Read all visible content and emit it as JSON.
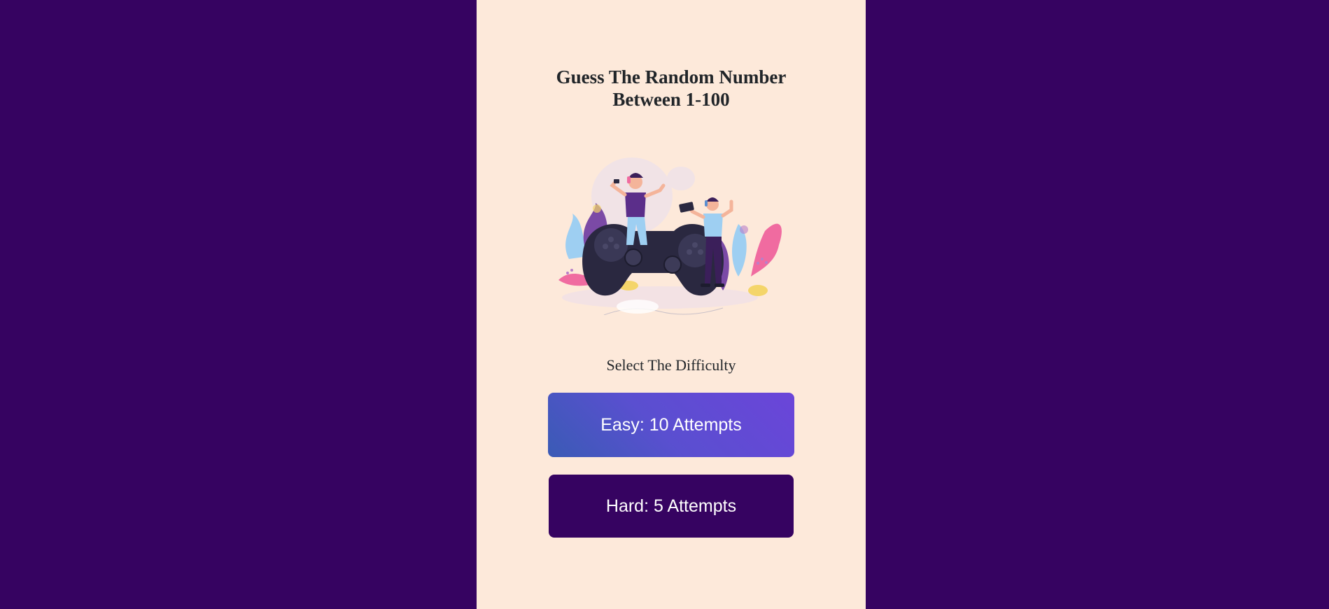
{
  "game": {
    "title_line1": "Guess The Random Number",
    "title_line2": "Between 1-100",
    "difficulty_prompt": "Select The Difficulty",
    "buttons": {
      "easy_label": "Easy: 10 Attempts",
      "hard_label": "Hard: 5 Attempts"
    },
    "illustration_alt": "gamers-illustration"
  },
  "colors": {
    "background": "#360361",
    "panel": "#fde9da",
    "text": "#212529",
    "easy_gradient_start": "#3a5bb5",
    "easy_gradient_end": "#6b45d9",
    "hard_button": "#360361"
  }
}
